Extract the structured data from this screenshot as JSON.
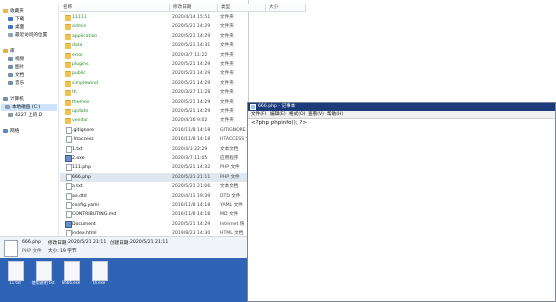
{
  "nav": {
    "items": [
      {
        "label": "收藏夹",
        "color": "#e8b84a"
      },
      {
        "label": "下载",
        "color": "#3a77c9"
      },
      {
        "label": "桌面",
        "color": "#3a77c9"
      },
      {
        "label": "最近访问的位置",
        "color": "#8aa5c4"
      },
      {
        "label": "库",
        "color": "#e0b04a"
      },
      {
        "label": "视频",
        "color": "#6f8fb3"
      },
      {
        "label": "图片",
        "color": "#6f8fb3"
      },
      {
        "label": "文档",
        "color": "#6f8fb3"
      },
      {
        "label": "音乐",
        "color": "#6f8fb3"
      },
      {
        "label": "计算机",
        "color": "#7a8da6"
      },
      {
        "label": "本地磁盘 (C:)",
        "color": "#8c98a8"
      },
      {
        "label": "4227 上的 D",
        "color": "#8c98a8"
      },
      {
        "label": "网络",
        "color": "#5a86c4"
      }
    ]
  },
  "list": {
    "columns": [
      "名称",
      "修改日期",
      "类型",
      "大小"
    ],
    "rows": [
      {
        "name": "11111",
        "date": "2020/4/14 15:51",
        "type": "文件夹",
        "kind": "folder"
      },
      {
        "name": "admin",
        "date": "2020/5/21 14:29",
        "type": "文件夹",
        "kind": "folder"
      },
      {
        "name": "application",
        "date": "2020/5/21 14:29",
        "type": "文件夹",
        "kind": "folder"
      },
      {
        "name": "data",
        "date": "2020/5/21 14:31",
        "type": "文件夹",
        "kind": "folder"
      },
      {
        "name": "error",
        "date": "2020/3/7 11:22",
        "type": "文件夹",
        "kind": "folder"
      },
      {
        "name": "plugins",
        "date": "2020/5/21 14:29",
        "type": "文件夹",
        "kind": "folder"
      },
      {
        "name": "public",
        "date": "2020/5/21 14:29",
        "type": "文件夹",
        "kind": "folder"
      },
      {
        "name": "simplewind",
        "date": "2020/5/21 14:29",
        "type": "文件夹",
        "kind": "folder"
      },
      {
        "name": "th",
        "date": "2020/3/27 11:28",
        "type": "文件夹",
        "kind": "folder"
      },
      {
        "name": "themes",
        "date": "2020/5/21 14:29",
        "type": "文件夹",
        "kind": "folder"
      },
      {
        "name": "update",
        "date": "2020/5/21 14:29",
        "type": "文件夹",
        "kind": "folder"
      },
      {
        "name": "vendor",
        "date": "2020/4/16 9:02",
        "type": "文件夹",
        "kind": "folder"
      },
      {
        "name": ".gitignore",
        "date": "2016/11/8 14:18",
        "type": "GITIGNORE 文件",
        "kind": "file"
      },
      {
        "name": ".htaccess",
        "date": "2016/11/8 14:18",
        "type": "HTACCESS 文件",
        "kind": "file"
      },
      {
        "name": "1.txt",
        "date": "2020/4/3 22:29",
        "type": "文本文档",
        "kind": "file"
      },
      {
        "name": "2.exe",
        "date": "2020/3/7 11:05",
        "type": "应用程序",
        "kind": "exe"
      },
      {
        "name": "111.php",
        "date": "2020/5/21 14:32",
        "type": "PHP 文件",
        "kind": "file"
      },
      {
        "name": "666.php",
        "date": "2020/5/21 21:11",
        "type": "PHP 文件",
        "kind": "file",
        "selected": true
      },
      {
        "name": "a.txt",
        "date": "2020/5/21 21:06",
        "type": "文本文档",
        "kind": "file"
      },
      {
        "name": "aa.dtd",
        "date": "2020/4/11 19:39",
        "type": "DTD 文件",
        "kind": "file"
      },
      {
        "name": "config.yaml",
        "date": "2016/11/8 14:18",
        "type": "YAML 文件",
        "kind": "file"
      },
      {
        "name": "CONTRIBUTING.md",
        "date": "2016/11/8 14:18",
        "type": "MD 文件",
        "kind": "file"
      },
      {
        "name": "Document",
        "date": "2020/5/21 14:29",
        "type": "Internet 快",
        "kind": "exe"
      },
      {
        "name": "index.html",
        "date": "2019/8/23 14:30",
        "type": "HTML 文档",
        "kind": "file"
      }
    ]
  },
  "details": {
    "filename": "666.php",
    "modified_label": "修改日期:",
    "modified_value": "2020/5/21 21:11",
    "created_label": "创建日期:",
    "created_value": "2020/5/21 21:11",
    "type_line": "PHP 文件",
    "size_label": "大小:",
    "size_value": "19 字节"
  },
  "desktop_icons": [
    {
      "label": "11 txt"
    },
    {
      "label": "使用说明 txt"
    },
    {
      "label": "6666.exe"
    },
    {
      "label": "t4.exe"
    }
  ],
  "notepad": {
    "title": "666.php - 记事本",
    "menu": [
      "文件(F)",
      "编辑(E)",
      "格式(O)",
      "查看(V)",
      "帮助(H)"
    ],
    "content": "<?php phpinfo(); ?>"
  }
}
